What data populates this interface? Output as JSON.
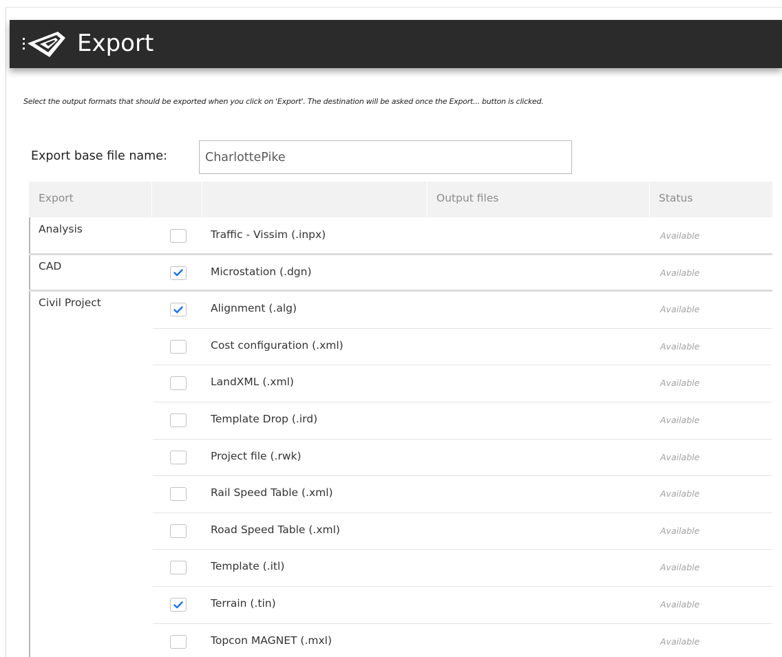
{
  "window": {
    "title": "Export",
    "icon": "road-perspective-icon",
    "colors": {
      "titlebar": "#2b2b2b",
      "title_text": "#ffffff",
      "check": "#1a73e8",
      "status_text": "#a2a2a2"
    }
  },
  "instructions": "Select the output formats that should be exported when you click on 'Export'. The destination will be asked once the Export... button is clicked.",
  "filename": {
    "label": "Export base file name:",
    "value": "CharlottePike"
  },
  "table": {
    "headers": [
      "Export",
      "",
      "",
      "Output files",
      "Status"
    ],
    "groups": [
      {
        "name": "Analysis",
        "rows": [
          {
            "label": "Traffic - Vissim (.inpx)",
            "checked": false,
            "status": "Available"
          }
        ]
      },
      {
        "name": "CAD",
        "rows": [
          {
            "label": "Microstation (.dgn)",
            "checked": true,
            "status": "Available"
          }
        ]
      },
      {
        "name": "Civil Project",
        "rows": [
          {
            "label": "Alignment (.alg)",
            "checked": true,
            "status": "Available"
          },
          {
            "label": "Cost configuration (.xml)",
            "checked": false,
            "status": "Available"
          },
          {
            "label": "LandXML (.xml)",
            "checked": false,
            "status": "Available"
          },
          {
            "label": "Template Drop (.ird)",
            "checked": false,
            "status": "Available"
          },
          {
            "label": "Project file (.rwk)",
            "checked": false,
            "status": "Available"
          },
          {
            "label": "Rail Speed Table (.xml)",
            "checked": false,
            "status": "Available"
          },
          {
            "label": "Road Speed Table (.xml)",
            "checked": false,
            "status": "Available"
          },
          {
            "label": "Template (.itl)",
            "checked": false,
            "status": "Available"
          },
          {
            "label": "Terrain (.tin)",
            "checked": true,
            "status": "Available"
          },
          {
            "label": "Topcon MAGNET (.mxl)",
            "checked": false,
            "status": "Available"
          }
        ]
      }
    ]
  }
}
